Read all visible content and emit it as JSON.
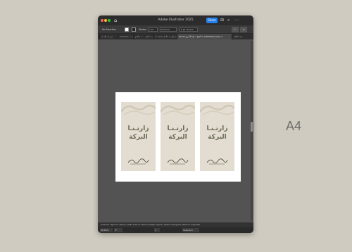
{
  "app": {
    "title": "Adobe Illustrator 2025",
    "share_label": "Share",
    "icons": [
      "home-icon",
      "window-arrange-icon",
      "search-icon",
      "options-icon"
    ]
  },
  "control_bar": {
    "selection_label": "No Selection",
    "stroke_label": "Stroke:",
    "stroke_value": "1 pt",
    "stroke_style": "Uniform",
    "brush_value": "5 pt. Round",
    "fill_color": "#ffffff",
    "stroke_color": "#222222"
  },
  "tabs": [
    {
      "label": "غير 3 علاد ار"
    },
    {
      "label": "Untitled-... ×"
    },
    {
      "label": "اورد ٢ لعان ...× ماكدو"
    },
    {
      "label": "إجر 2 عالدل 5-لجد ك ×"
    },
    {
      "label": "افتح ٦ @ الأسرح 66.66 % (CMYK/Preview) ×",
      "active": true
    },
    {
      "label": "فيه التعلم"
    }
  ],
  "canvas": {
    "cards": [
      {
        "line1": "زارتـنـا",
        "line2": "البركة"
      },
      {
        "line1": "زارتـنـا",
        "line2": "البركة"
      },
      {
        "line1": "زارتـنـا",
        "line2": "البركة"
      }
    ]
  },
  "status": {
    "hint": "Click the object to select  |  Shift+Click to select multiple object  |  Option+Drag the object to duplicate",
    "zoom": "66.66%",
    "rotation": "0°",
    "artboard_nav": "1",
    "tool": "Selection"
  },
  "side_label": "A4",
  "colors": {
    "background": "#cfcbc0",
    "card": "#e2ddd0",
    "accent": "#2680eb"
  }
}
